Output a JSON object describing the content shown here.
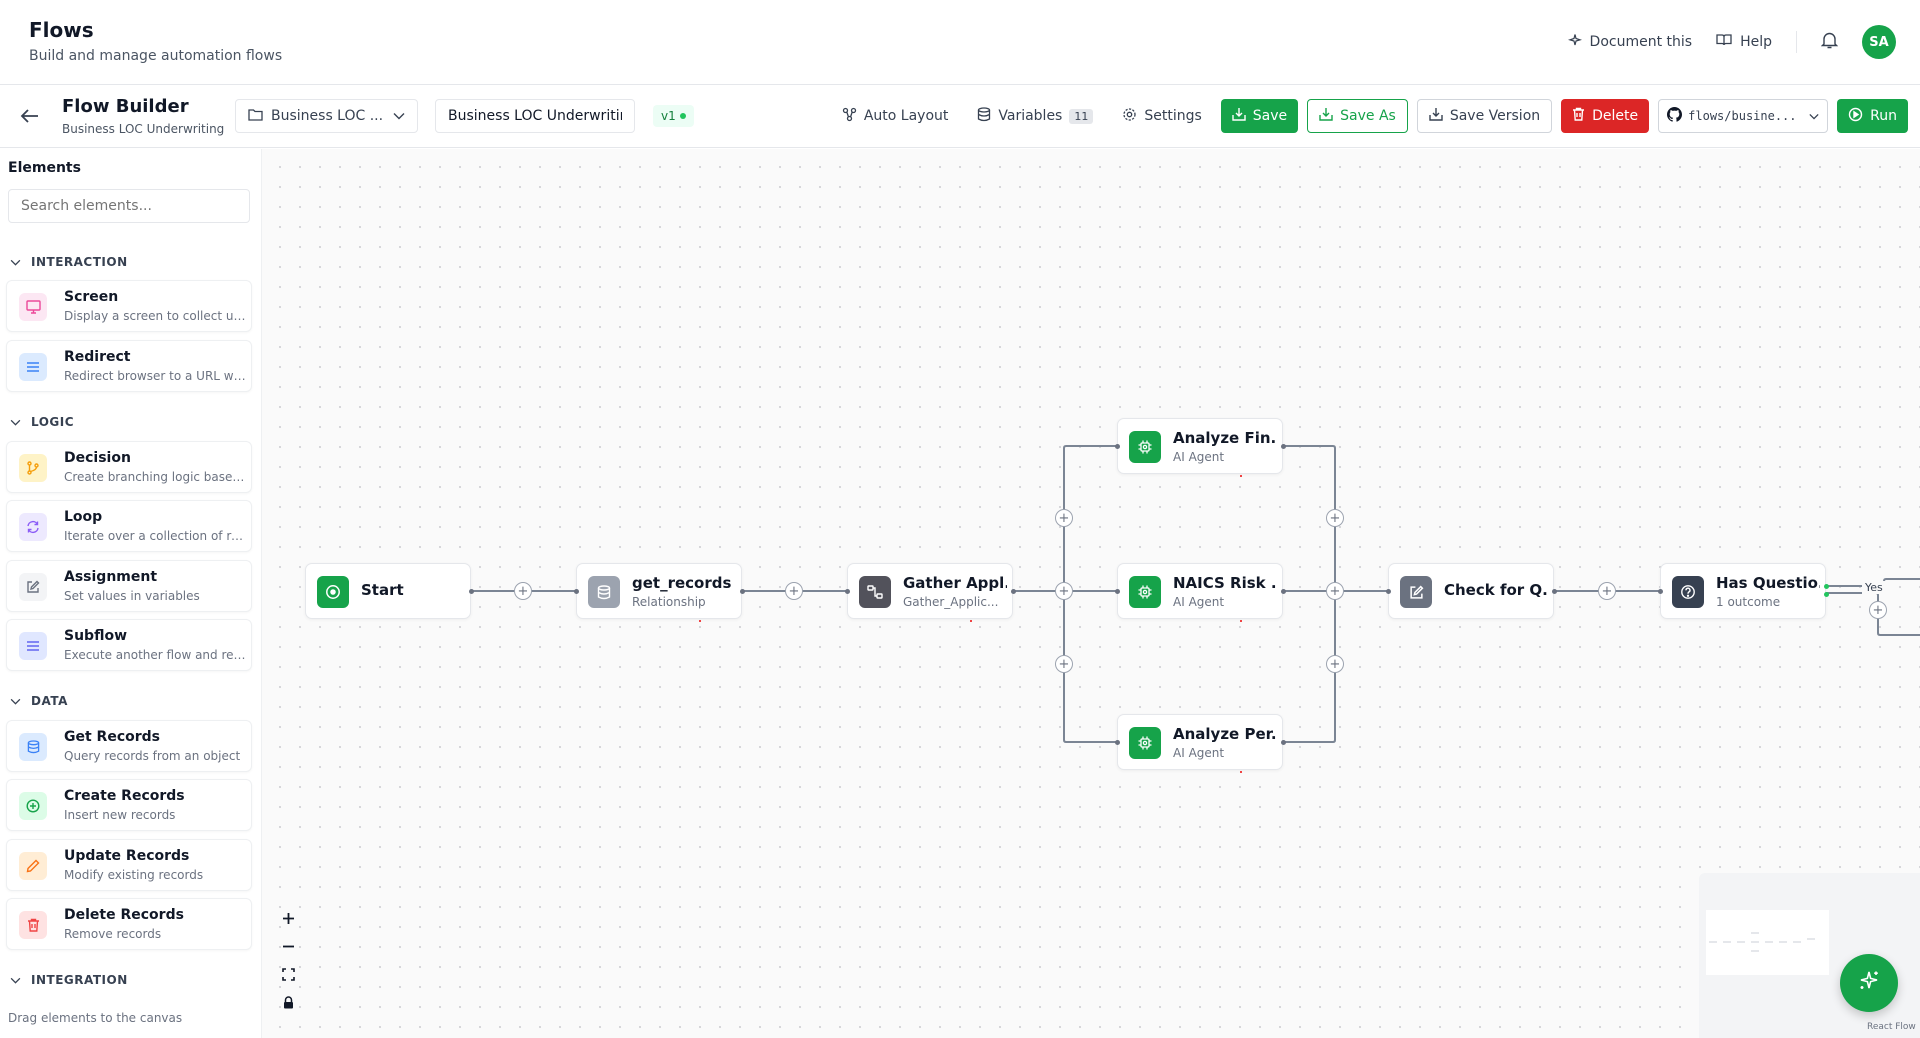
{
  "header": {
    "title": "Flows",
    "subtitle": "Build and manage automation flows",
    "document_this": "Document this",
    "help": "Help",
    "avatar_initials": "SA"
  },
  "toolbar": {
    "title": "Flow Builder",
    "subtitle": "Business LOC Underwriting",
    "folder": "Business LOC ...",
    "flow_name": "Business LOC Underwritin",
    "version": "v1",
    "auto_layout": "Auto Layout",
    "variables": "Variables",
    "variables_count": "11",
    "settings": "Settings",
    "save": "Save",
    "save_as": "Save As",
    "save_version": "Save Version",
    "delete": "Delete",
    "repo": "flows/busine...",
    "run": "Run"
  },
  "sidebar": {
    "title": "Elements",
    "search_placeholder": "Search elements...",
    "categories": [
      {
        "name": "INTERACTION",
        "items": [
          {
            "title": "Screen",
            "desc": "Display a screen to collect us...",
            "icon": "screen-icon",
            "color": "#ec4899",
            "bg": "#fce7f3"
          },
          {
            "title": "Redirect",
            "desc": "Redirect browser to a URL wi...",
            "icon": "redirect-icon",
            "color": "#3b82f6",
            "bg": "#dbeafe"
          }
        ]
      },
      {
        "name": "LOGIC",
        "items": [
          {
            "title": "Decision",
            "desc": "Create branching logic based...",
            "icon": "branch-icon",
            "color": "#f59e0b",
            "bg": "#fef3c7"
          },
          {
            "title": "Loop",
            "desc": "Iterate over a collection of re...",
            "icon": "loop-icon",
            "color": "#8b5cf6",
            "bg": "#ede9fe"
          },
          {
            "title": "Assignment",
            "desc": "Set values in variables",
            "icon": "pencil-square-icon",
            "color": "#6b7280",
            "bg": "#f3f4f6"
          },
          {
            "title": "Subflow",
            "desc": "Execute another flow and ret...",
            "icon": "list-icon",
            "color": "#6366f1",
            "bg": "#e0e7ff"
          }
        ]
      },
      {
        "name": "DATA",
        "items": [
          {
            "title": "Get Records",
            "desc": "Query records from an object",
            "icon": "database-icon",
            "color": "#3b82f6",
            "bg": "#dbeafe"
          },
          {
            "title": "Create Records",
            "desc": "Insert new records",
            "icon": "plus-circle-icon",
            "color": "#16a34a",
            "bg": "#dcfce7"
          },
          {
            "title": "Update Records",
            "desc": "Modify existing records",
            "icon": "pencil-icon",
            "color": "#f97316",
            "bg": "#ffedd5"
          },
          {
            "title": "Delete Records",
            "desc": "Remove records",
            "icon": "trash-icon",
            "color": "#ef4444",
            "bg": "#fee2e2"
          }
        ]
      },
      {
        "name": "INTEGRATION",
        "items": []
      }
    ],
    "footer": "Drag elements to the canvas"
  },
  "canvas": {
    "nodes": [
      {
        "id": "start",
        "title": "Start",
        "subtitle": "",
        "icon": "play-circle-icon",
        "color": "#16a34a"
      },
      {
        "id": "get_records",
        "title": "get_records",
        "subtitle": "Relationship",
        "icon": "database-icon",
        "color": "#9ca3af"
      },
      {
        "id": "gather",
        "title": "Gather Appl...",
        "subtitle": "Gather_Applic...",
        "icon": "transform-icon",
        "color": "#52525b"
      },
      {
        "id": "analyze_fin",
        "title": "Analyze Fin...",
        "subtitle": "AI Agent",
        "icon": "ai-chip-icon",
        "color": "#16a34a"
      },
      {
        "id": "naics",
        "title": "NAICS Risk ...",
        "subtitle": "AI Agent",
        "icon": "ai-chip-icon",
        "color": "#16a34a"
      },
      {
        "id": "analyze_per",
        "title": "Analyze Per...",
        "subtitle": "AI Agent",
        "icon": "ai-chip-icon",
        "color": "#16a34a"
      },
      {
        "id": "check",
        "title": "Check for Q...",
        "subtitle": "",
        "icon": "pencil-square-icon",
        "color": "#6b7280"
      },
      {
        "id": "has_questions",
        "title": "Has Questio...",
        "subtitle": "1 outcome",
        "icon": "question-circle-icon",
        "color": "#374151"
      }
    ],
    "yes_label": "Yes",
    "attribution": "React Flow"
  }
}
